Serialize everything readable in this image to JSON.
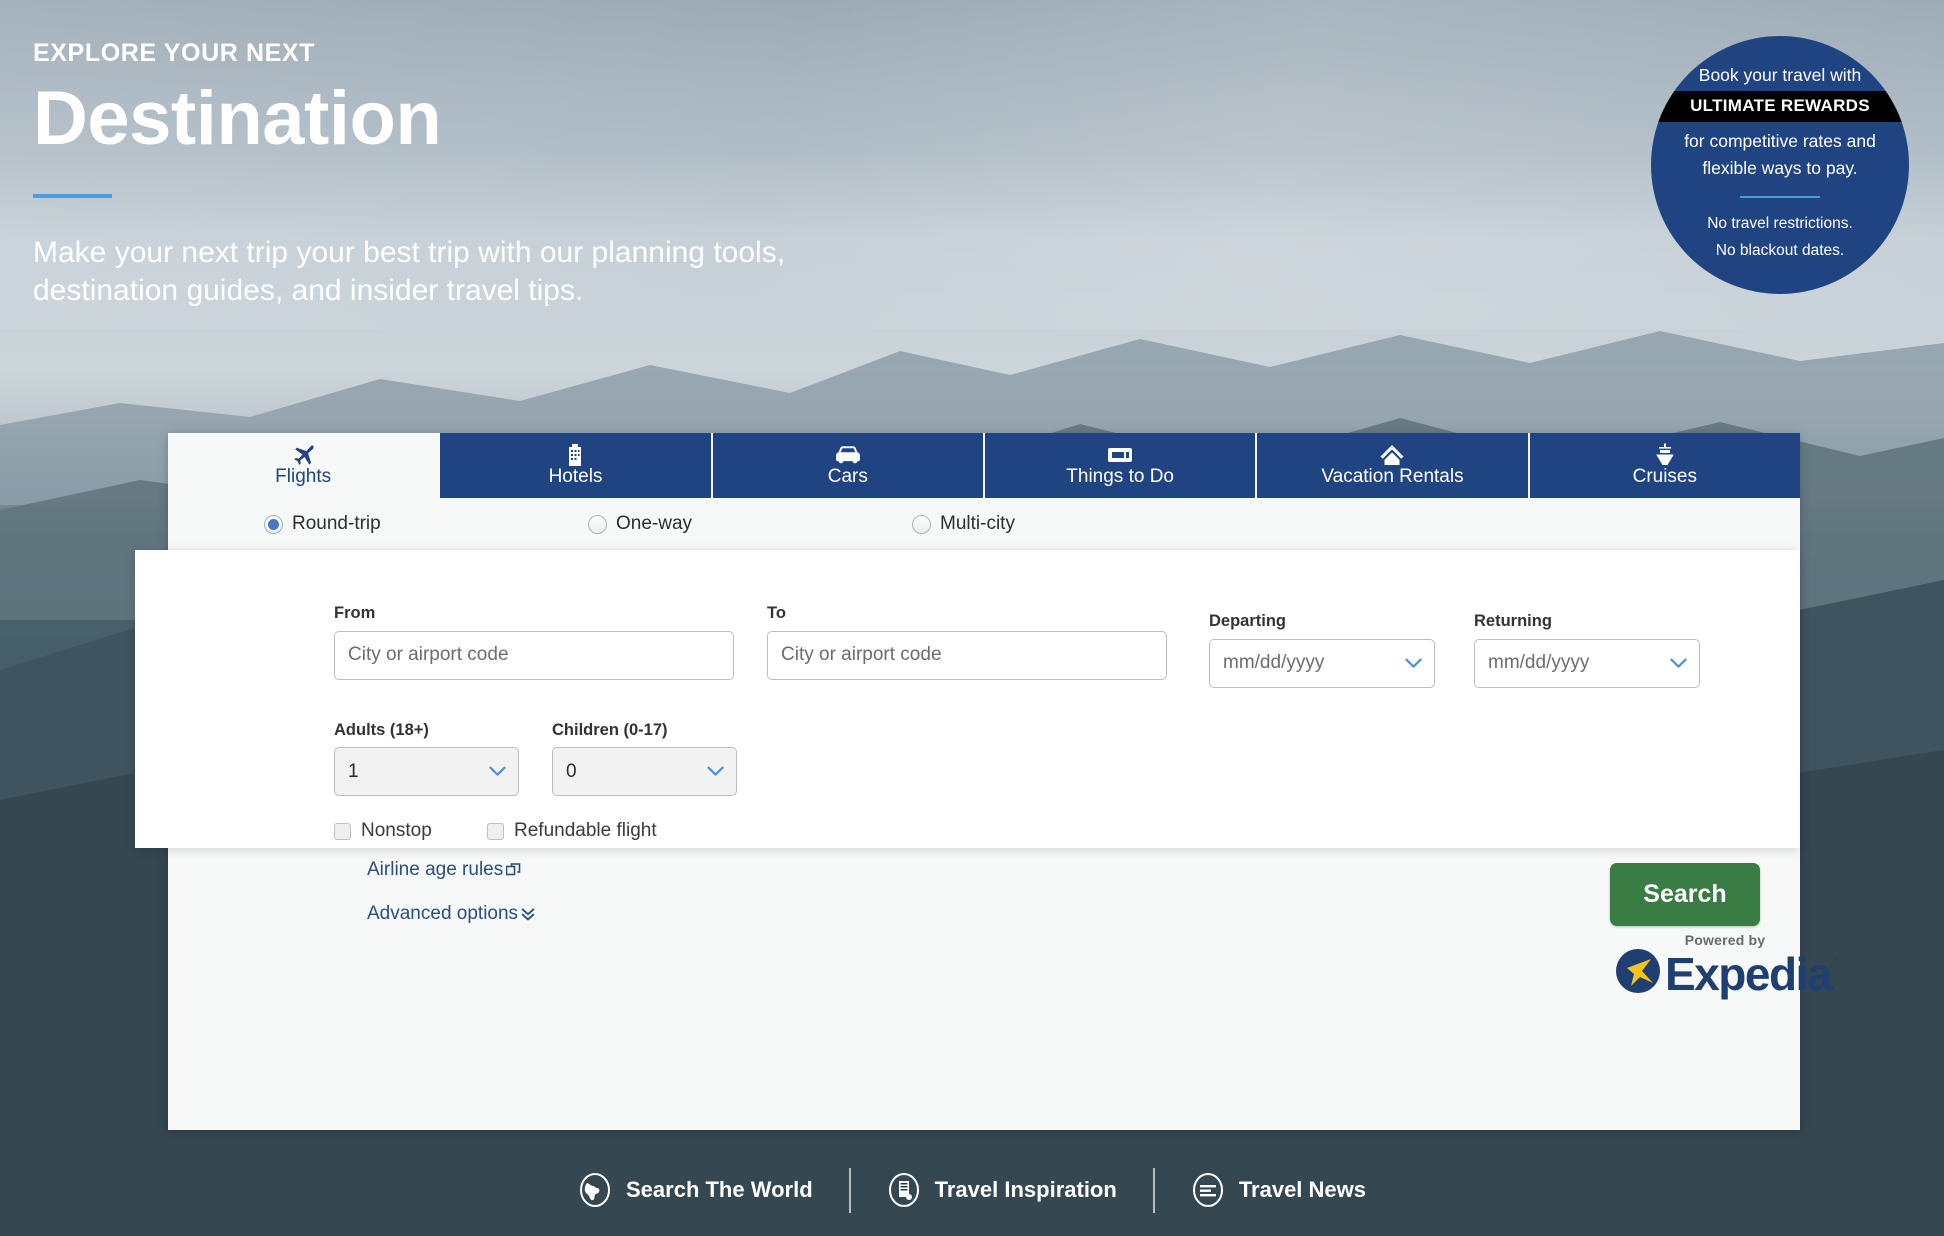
{
  "hero": {
    "eyebrow": "EXPLORE YOUR NEXT",
    "title": "Destination",
    "subtitle": "Make your next trip your best trip with our planning tools, destination guides, and insider travel tips."
  },
  "badge": {
    "line1": "Book your travel with",
    "band": "ULTIMATE REWARDS",
    "line2": "for competitive rates and flexible ways to pay.",
    "line3a": "No travel restrictions.",
    "line3b": "No blackout dates.",
    "bg_color": "#1f4481",
    "rule_color": "#4a9ee0"
  },
  "booking": {
    "tabs": [
      {
        "label": "Flights",
        "icon": "airplane-icon",
        "active": true
      },
      {
        "label": "Hotels",
        "icon": "building-icon",
        "active": false
      },
      {
        "label": "Cars",
        "icon": "car-icon",
        "active": false
      },
      {
        "label": "Things to Do",
        "icon": "ticket-icon",
        "active": false
      },
      {
        "label": "Vacation Rentals",
        "icon": "home-icon",
        "active": false
      },
      {
        "label": "Cruises",
        "icon": "cruise-ship-icon",
        "active": false
      }
    ],
    "trip_types": [
      {
        "label": "Round-trip",
        "selected": true
      },
      {
        "label": "One-way",
        "selected": false
      },
      {
        "label": "Multi-city",
        "selected": false
      }
    ],
    "fields": {
      "from_label": "From",
      "from_value": "",
      "from_placeholder": "City or airport code",
      "to_label": "To",
      "to_value": "",
      "to_placeholder": "City or airport code",
      "departing_label": "Departing",
      "departing_value": "mm/dd/yyyy",
      "returning_label": "Returning",
      "returning_value": "mm/dd/yyyy",
      "adults_label": "Adults (18+)",
      "adults_value": "1",
      "children_label": "Children (0-17)",
      "children_value": "0"
    },
    "checkboxes": [
      {
        "label": "Nonstop",
        "checked": false
      },
      {
        "label": "Refundable flight",
        "checked": false
      }
    ],
    "links": [
      {
        "label": "Airline age rules",
        "icon": "external-link-icon"
      },
      {
        "label": "Advanced options",
        "icon": "chevron-double-down-icon"
      }
    ],
    "search_label": "Search",
    "search_color": "#3a7d44",
    "powered_by": "Powered by",
    "provider": "Expedia",
    "provider_tm": "·"
  },
  "bottom_nav": [
    {
      "label": "Search The World",
      "icon": "globe-icon"
    },
    {
      "label": "Travel Inspiration",
      "icon": "book-icon"
    },
    {
      "label": "Travel News",
      "icon": "news-icon"
    }
  ]
}
